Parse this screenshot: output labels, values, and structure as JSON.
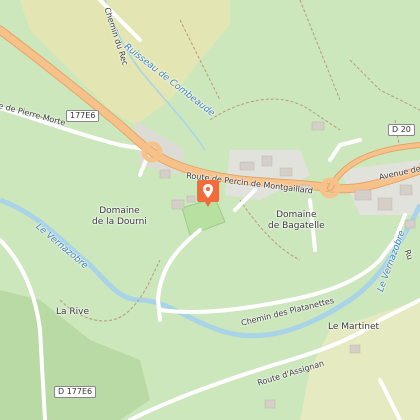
{
  "colors": {
    "background": "#cfe8c0",
    "vineyard": "#c3e1b0",
    "meadow": "#e5e6b0",
    "river": "#a9d4e8",
    "road_main": "#f6c28a",
    "road_minor": "#ffffff",
    "marker": "#f26b3a"
  },
  "marker": {
    "icon": "map-pin-icon"
  },
  "labels": {
    "chemin_rec": "Chemin du Rec",
    "ruisseau": "Ruisseau de Combeaude",
    "pierre_morte": "e de Pierre-Morte",
    "route_percin": "Route de Percin de Montgaillard",
    "avenue": "Avenue de",
    "domaine_dourni_1": "Domaine",
    "domaine_dourni_2": "de la Dourni",
    "domaine_bagatelle_1": "Domaine",
    "domaine_bagatelle_2": "de Bagatelle",
    "vernazobre_left": "Le Vernazobre",
    "vernazobre_right": "Le Vernazobre",
    "la_rive": "La Rive",
    "chemin_platanettes": "Chemin des Platanettes",
    "le_martinet": "Le Martinet",
    "route_assignan": "Route d'Assignan",
    "ru_right": "Ru"
  },
  "shields": {
    "d177e6_top": "177E6",
    "d20": "D 20",
    "d177e6_bottom": "D 177E6"
  }
}
